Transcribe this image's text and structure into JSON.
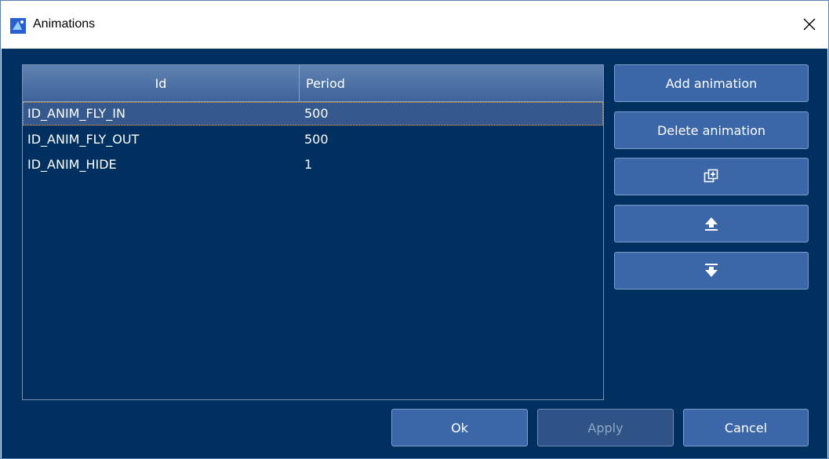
{
  "window": {
    "title": "Animations",
    "app_icon": "app-icon",
    "close_icon": "close-icon"
  },
  "table": {
    "columns": [
      "Id",
      "Period"
    ],
    "rows": [
      {
        "id": "ID_ANIM_FLY_IN",
        "period": "500",
        "selected": true
      },
      {
        "id": "ID_ANIM_FLY_OUT",
        "period": "500",
        "selected": false
      },
      {
        "id": "ID_ANIM_HIDE",
        "period": "1",
        "selected": false
      }
    ]
  },
  "side_buttons": {
    "add_label": "Add animation",
    "delete_label": "Delete animation",
    "duplicate_icon": "duplicate-icon",
    "move_up_icon": "move-up-icon",
    "move_down_icon": "move-down-icon"
  },
  "footer": {
    "ok_label": "Ok",
    "apply_label": "Apply",
    "cancel_label": "Cancel"
  },
  "colors": {
    "background": "#003060",
    "button": "#3b67a8",
    "header": "#4f74a8",
    "selection": "#35598c"
  }
}
